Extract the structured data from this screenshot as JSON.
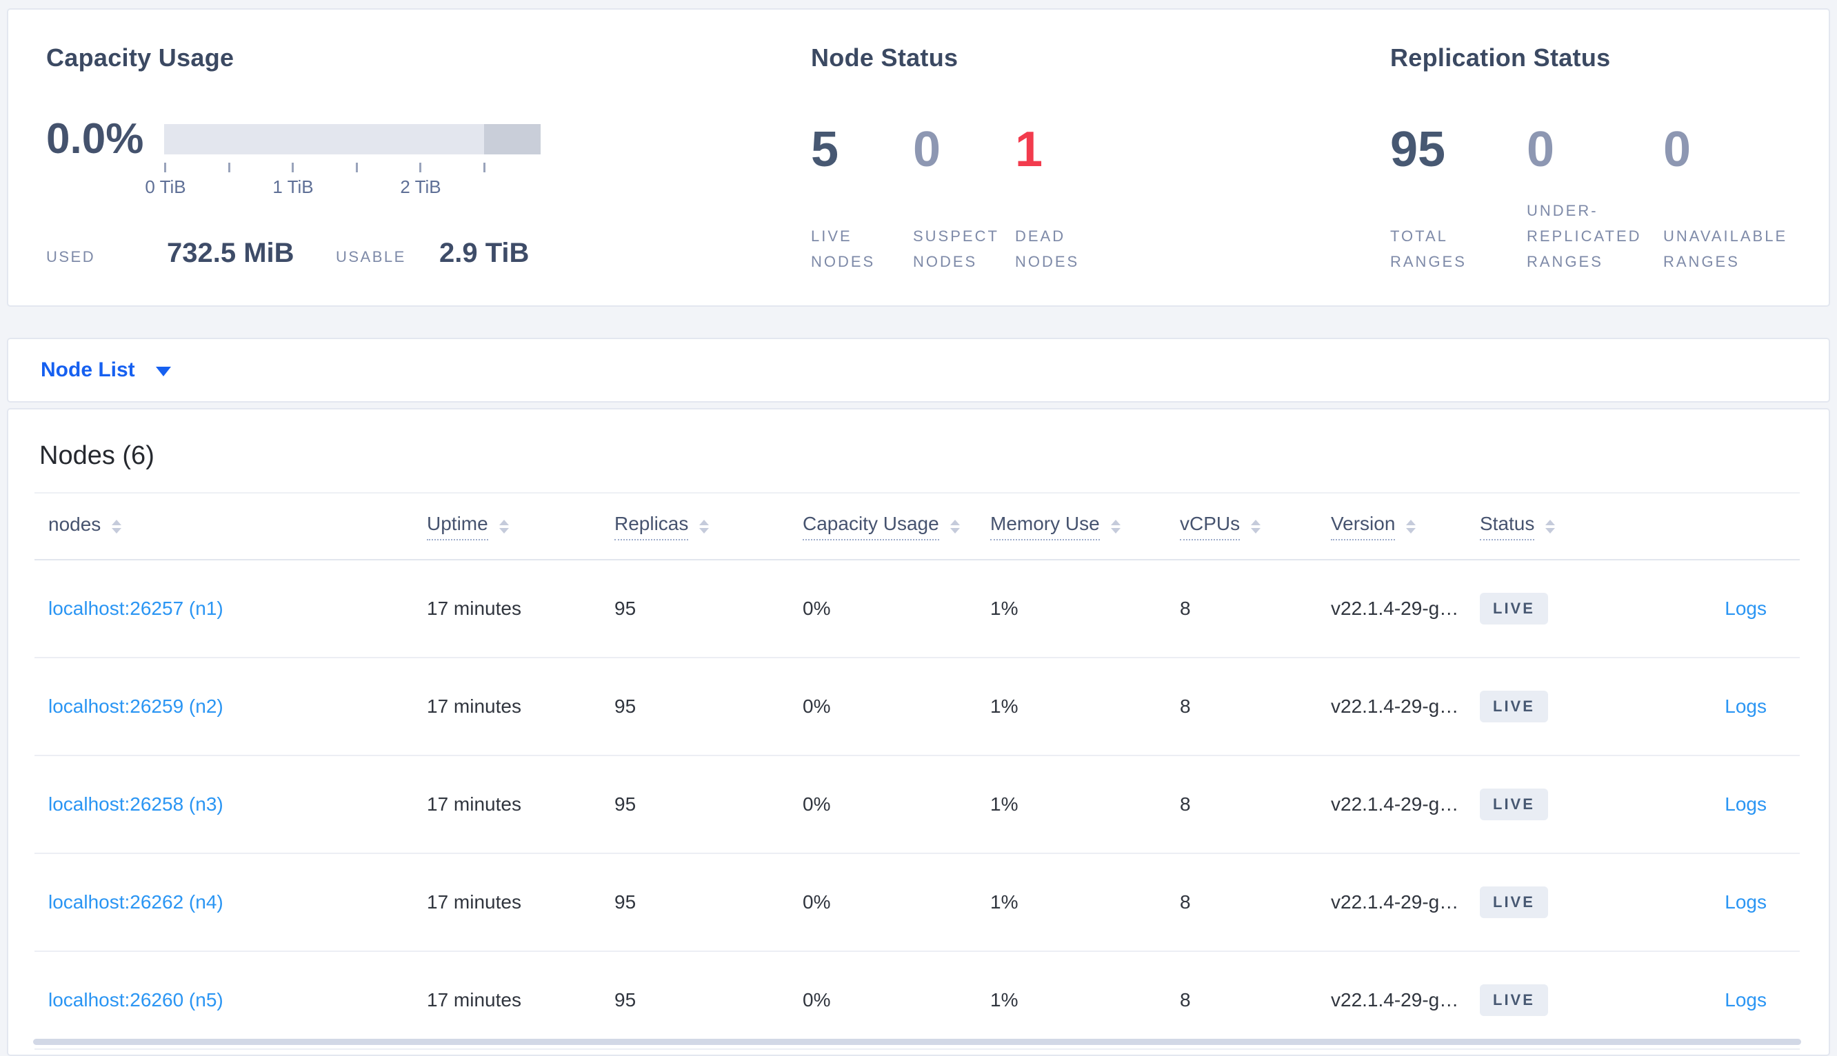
{
  "summary": {
    "capacity": {
      "title": "Capacity Usage",
      "percent": "0.0%",
      "axis_tick_count": 6,
      "axis_labels": [
        "0 TiB",
        "1 TiB",
        "2 TiB"
      ],
      "bar": {
        "track_color": "#e3e6ee",
        "overflow_color": "#c9ced9",
        "overflow_width_pct": 15,
        "used_pct": 0
      },
      "used_label": "USED",
      "used_value": "732.5 MiB",
      "usable_label": "USABLE",
      "usable_value": "2.9 TiB"
    },
    "node_status": {
      "title": "Node Status",
      "stats": [
        {
          "value": "5",
          "label": "LIVE\nNODES",
          "color": "#475872"
        },
        {
          "value": "0",
          "label": "SUSPECT\nNODES",
          "color": "#8d97b2"
        },
        {
          "value": "1",
          "label": "DEAD\nNODES",
          "color": "#f23b4d"
        }
      ]
    },
    "replication_status": {
      "title": "Replication Status",
      "stats": [
        {
          "value": "95",
          "label": "TOTAL\nRANGES",
          "color": "#475872"
        },
        {
          "value": "0",
          "label": "UNDER-\nREPLICATED\nRANGES",
          "color": "#8d97b2"
        },
        {
          "value": "0",
          "label": "UNAVAILABLE\nRANGES",
          "color": "#8d97b2"
        }
      ]
    }
  },
  "node_list_bar": {
    "label": "Node List"
  },
  "nodes_table": {
    "title": "Nodes (6)",
    "columns": [
      {
        "label": "nodes",
        "underline": false
      },
      {
        "label": "Uptime",
        "underline": true
      },
      {
        "label": "Replicas",
        "underline": true
      },
      {
        "label": "Capacity Usage",
        "underline": true
      },
      {
        "label": "Memory Use",
        "underline": true
      },
      {
        "label": "vCPUs",
        "underline": true
      },
      {
        "label": "Version",
        "underline": true
      },
      {
        "label": "Status",
        "underline": true
      }
    ],
    "rows": [
      {
        "address": "localhost:26257 (n1)",
        "uptime": "17 minutes",
        "replicas": "95",
        "capacity_usage": "0%",
        "memory_use": "1%",
        "vcpus": "8",
        "version": "v22.1.4-29-g…",
        "status": "LIVE",
        "logs": "Logs"
      },
      {
        "address": "localhost:26259 (n2)",
        "uptime": "17 minutes",
        "replicas": "95",
        "capacity_usage": "0%",
        "memory_use": "1%",
        "vcpus": "8",
        "version": "v22.1.4-29-g…",
        "status": "LIVE",
        "logs": "Logs"
      },
      {
        "address": "localhost:26258 (n3)",
        "uptime": "17 minutes",
        "replicas": "95",
        "capacity_usage": "0%",
        "memory_use": "1%",
        "vcpus": "8",
        "version": "v22.1.4-29-g…",
        "status": "LIVE",
        "logs": "Logs"
      },
      {
        "address": "localhost:26262 (n4)",
        "uptime": "17 minutes",
        "replicas": "95",
        "capacity_usage": "0%",
        "memory_use": "1%",
        "vcpus": "8",
        "version": "v22.1.4-29-g…",
        "status": "LIVE",
        "logs": "Logs"
      },
      {
        "address": "localhost:26260 (n5)",
        "uptime": "17 minutes",
        "replicas": "95",
        "capacity_usage": "0%",
        "memory_use": "1%",
        "vcpus": "8",
        "version": "v22.1.4-29-g…",
        "status": "LIVE",
        "logs": "Logs"
      }
    ]
  },
  "colors": {
    "link_blue": "#2a95f3",
    "dropdown_blue": "#1660f0",
    "dead_red": "#f23b4d",
    "badge_bg": "#e9edf4",
    "badge_text": "#475872"
  }
}
